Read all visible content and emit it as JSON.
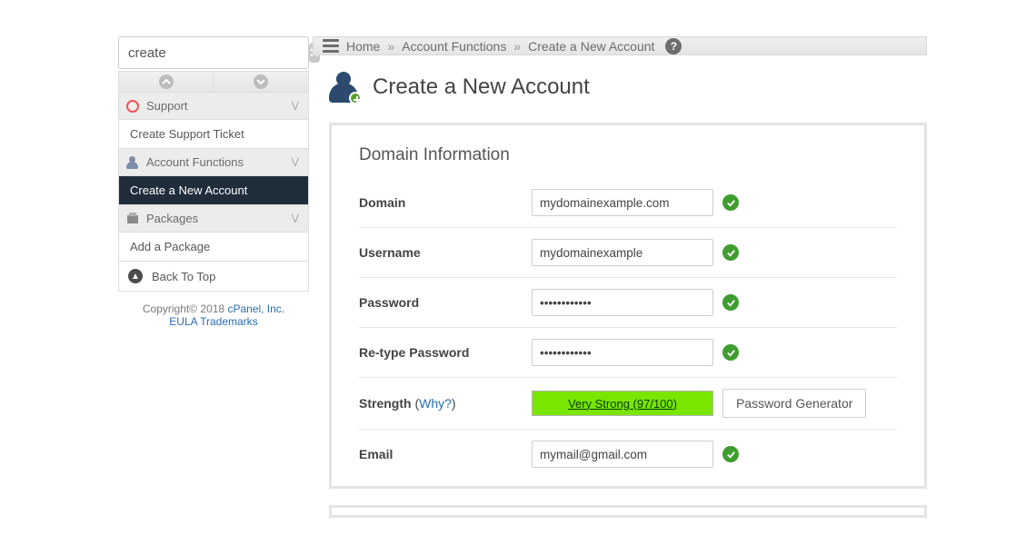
{
  "search": {
    "value": "create"
  },
  "sidebar": {
    "groups": [
      {
        "label": "Support",
        "items": [
          {
            "label": "Create Support Ticket"
          }
        ]
      },
      {
        "label": "Account Functions",
        "items": [
          {
            "label": "Create a New Account",
            "active": true
          }
        ]
      },
      {
        "label": "Packages",
        "items": [
          {
            "label": "Add a Package"
          }
        ]
      }
    ],
    "back_to_top": "Back To Top",
    "footer": {
      "copyright": "Copyright© 2018",
      "company": "cPanel, Inc.",
      "eula": "EULA",
      "trademarks": "Trademarks"
    }
  },
  "breadcrumb": {
    "items": [
      "Home",
      "Account Functions",
      "Create a New Account"
    ]
  },
  "page": {
    "title": "Create a New Account"
  },
  "panel": {
    "title": "Domain Information",
    "fields": {
      "domain": {
        "label": "Domain",
        "value": "mydomainexample.com"
      },
      "username": {
        "label": "Username",
        "value": "mydomainexample"
      },
      "password": {
        "label": "Password",
        "value": "••••••••••••"
      },
      "retype": {
        "label": "Re-type Password",
        "value": "••••••••••••"
      },
      "strength": {
        "label": "Strength",
        "why": "Why?",
        "value": "Very Strong (97/100)",
        "generator": "Password Generator"
      },
      "email": {
        "label": "Email",
        "value": "mymail@gmail.com"
      }
    }
  }
}
